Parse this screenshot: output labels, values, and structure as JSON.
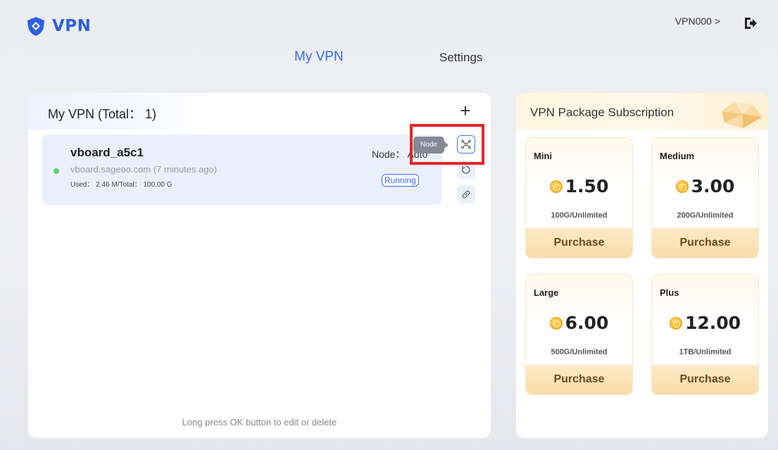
{
  "header": {
    "logo_text": "VPN",
    "user_label": "VPN000 >",
    "tabs": [
      {
        "label": "My VPN"
      },
      {
        "label": "Settings"
      }
    ]
  },
  "my_vpn": {
    "title": "My VPN (Total： 1)",
    "add_label": "+",
    "items": [
      {
        "name": "vboard_a5c1",
        "host": "vboard.sageoo.com  (7 minutes ago)",
        "usage": "Used： 2.46 M/Total： 100.00 G",
        "node": "Node： Auto",
        "status": "Running"
      }
    ],
    "tooltip": "Node",
    "footer_hint": "Long press OK button to edit or delete"
  },
  "subscription": {
    "title": "VPN Package Subscription",
    "packages": [
      {
        "name": "Mini",
        "price": "1.50",
        "desc": "100G/Unlimited",
        "button": "Purchase"
      },
      {
        "name": "Medium",
        "price": "3.00",
        "desc": "200G/Unlimited",
        "button": "Purchase"
      },
      {
        "name": "Large",
        "price": "6.00",
        "desc": "500G/Unlimited",
        "button": "Purchase"
      },
      {
        "name": "Plus",
        "price": "12.00",
        "desc": "1TB/Unlimited",
        "button": "Purchase"
      }
    ]
  },
  "colors": {
    "accent": "#2f6bf0",
    "status_online": "#5fcf6f",
    "highlight": "#e4262b"
  },
  "icons": [
    "shield-logo-icon",
    "logout-icon",
    "add-icon",
    "node-icon",
    "refresh-icon",
    "link-icon",
    "coin-icon",
    "gem-icon"
  ]
}
